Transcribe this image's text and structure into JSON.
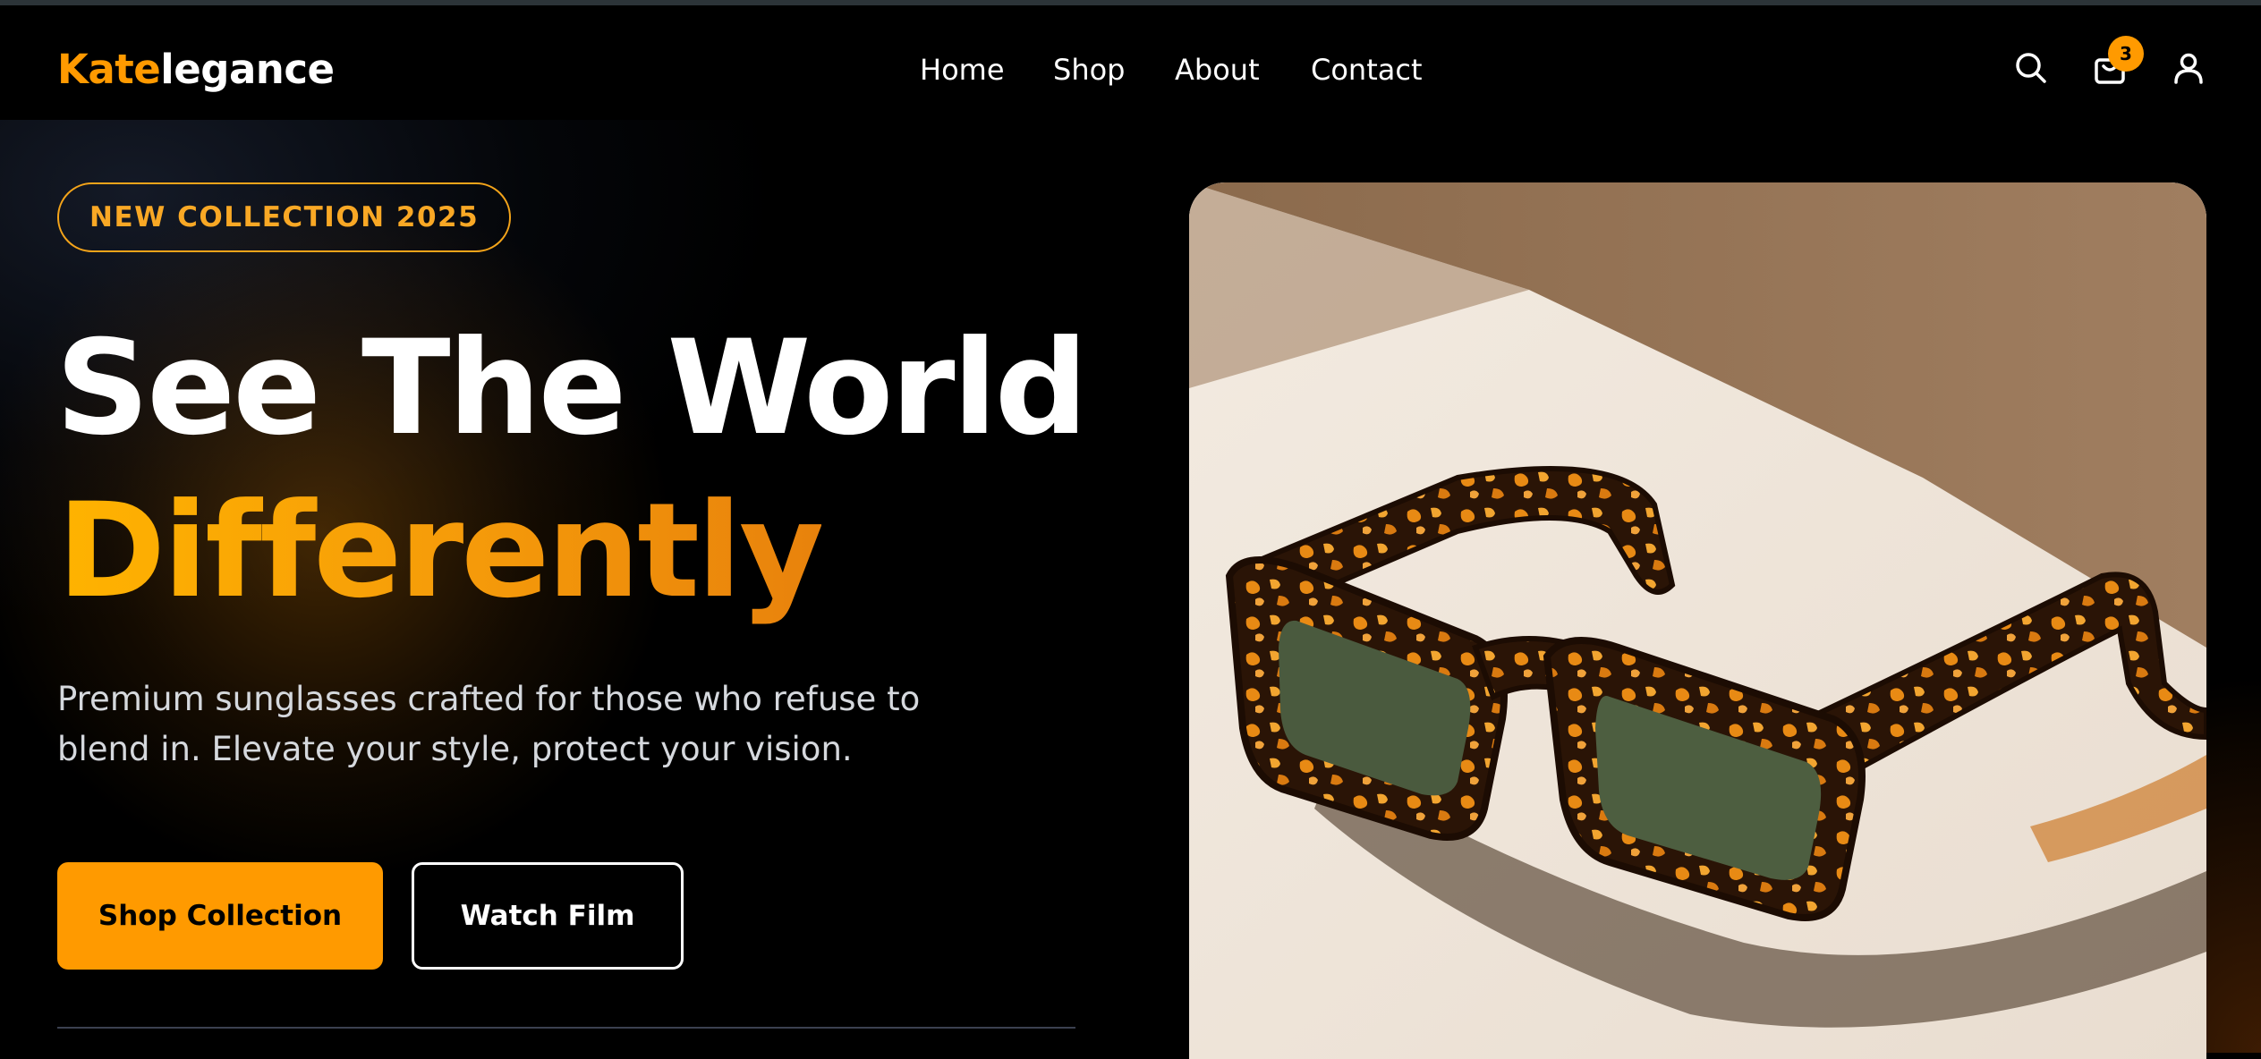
{
  "brand": {
    "part1": "Kate",
    "part2": "legance",
    "accent_color": "#ff9a00"
  },
  "nav": {
    "links": [
      "Home",
      "Shop",
      "About",
      "Contact"
    ],
    "icons": [
      "search-icon",
      "cart-icon",
      "user-icon"
    ],
    "cart_count": "3"
  },
  "hero": {
    "tag": "NEW COLLECTION 2025",
    "headline_line1": "See The World",
    "headline_line2": "Differently",
    "description": "Premium sunglasses crafted for those who refuse to blend in. Elevate your style, protect your vision.",
    "primary_button": "Shop Collection",
    "secondary_button": "Watch Film",
    "image_subject": "tortoiseshell-sunglasses"
  }
}
